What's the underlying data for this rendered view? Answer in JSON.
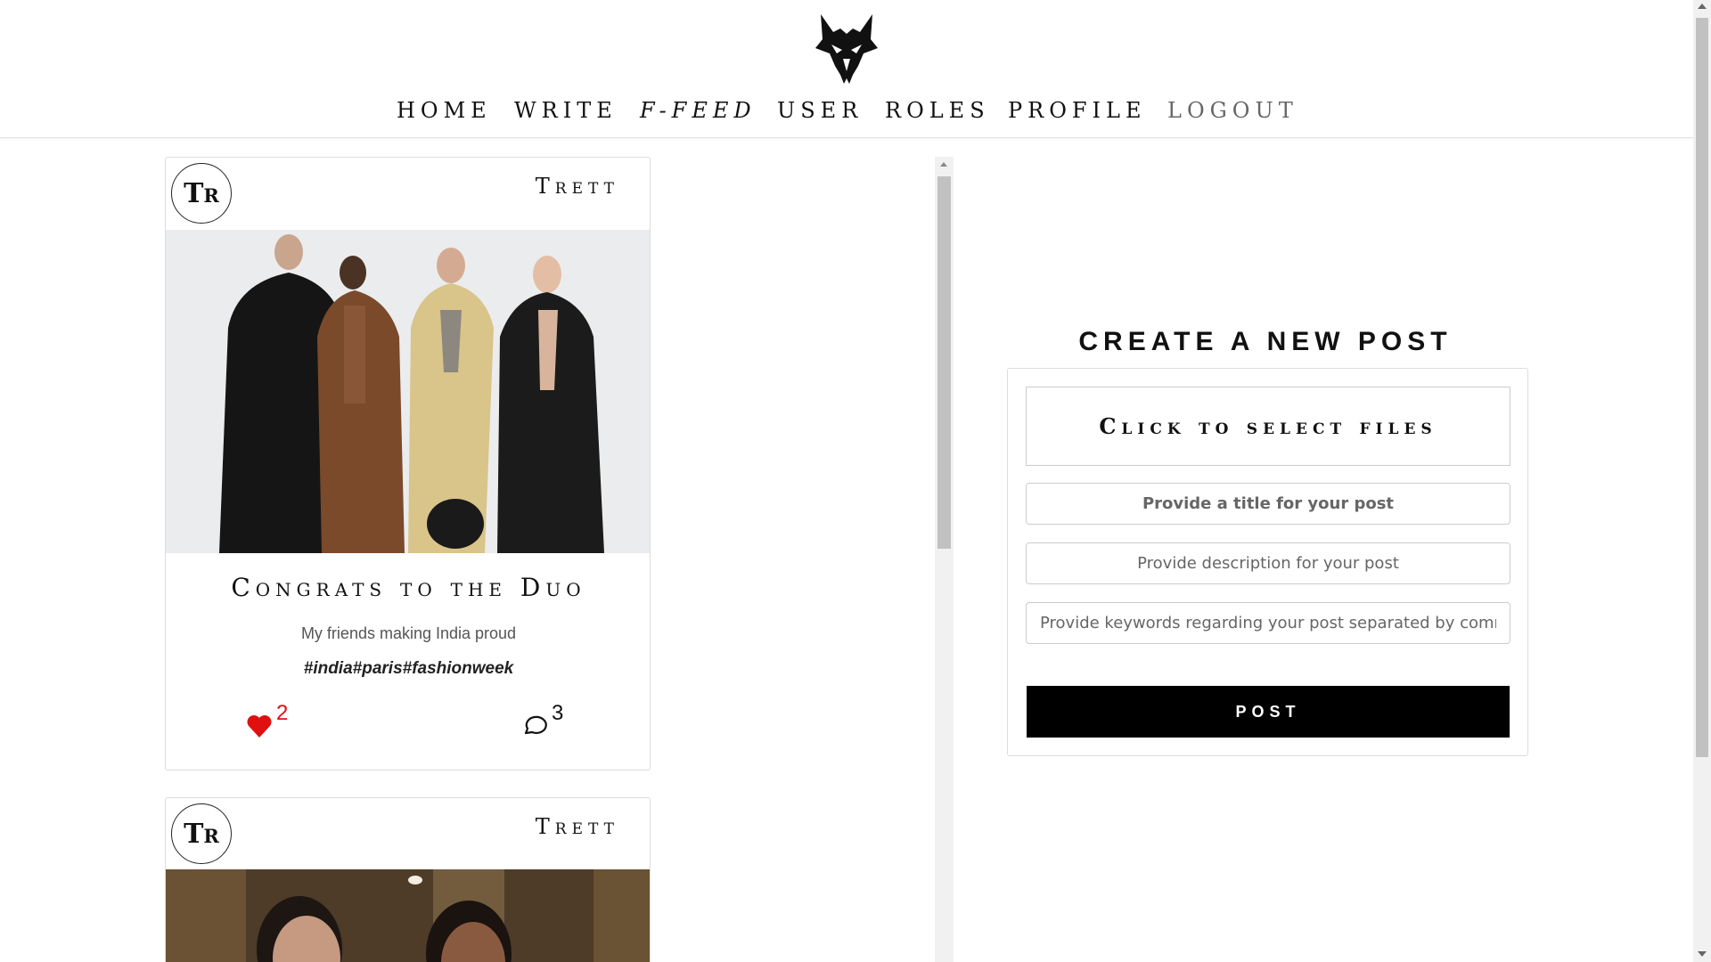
{
  "nav": {
    "items": [
      {
        "label": "Home"
      },
      {
        "label": "Write"
      },
      {
        "label": "f-Feed"
      },
      {
        "label": "User"
      },
      {
        "label": "Roles"
      },
      {
        "label": "Profile"
      },
      {
        "label": "Logout"
      }
    ]
  },
  "feed": {
    "posts": [
      {
        "avatar_initials": "Tr",
        "author": "Trett",
        "title": "Congrats to the Duo",
        "description": "My friends making India proud",
        "tags": "#india#paris#fashionweek",
        "likes": "2",
        "comments": "3"
      },
      {
        "avatar_initials": "Tr",
        "author": "Trett"
      }
    ]
  },
  "create_post": {
    "heading": "CREATE A NEW POST",
    "file_select_label": "Click to select files",
    "title_placeholder": "Provide a title for your post",
    "description_placeholder": "Provide description for your post",
    "keywords_placeholder": "Provide keywords regarding your post separated by comma",
    "post_button": "POST"
  },
  "colors": {
    "like_heart": "#e01010",
    "post_button_bg": "#000000"
  }
}
